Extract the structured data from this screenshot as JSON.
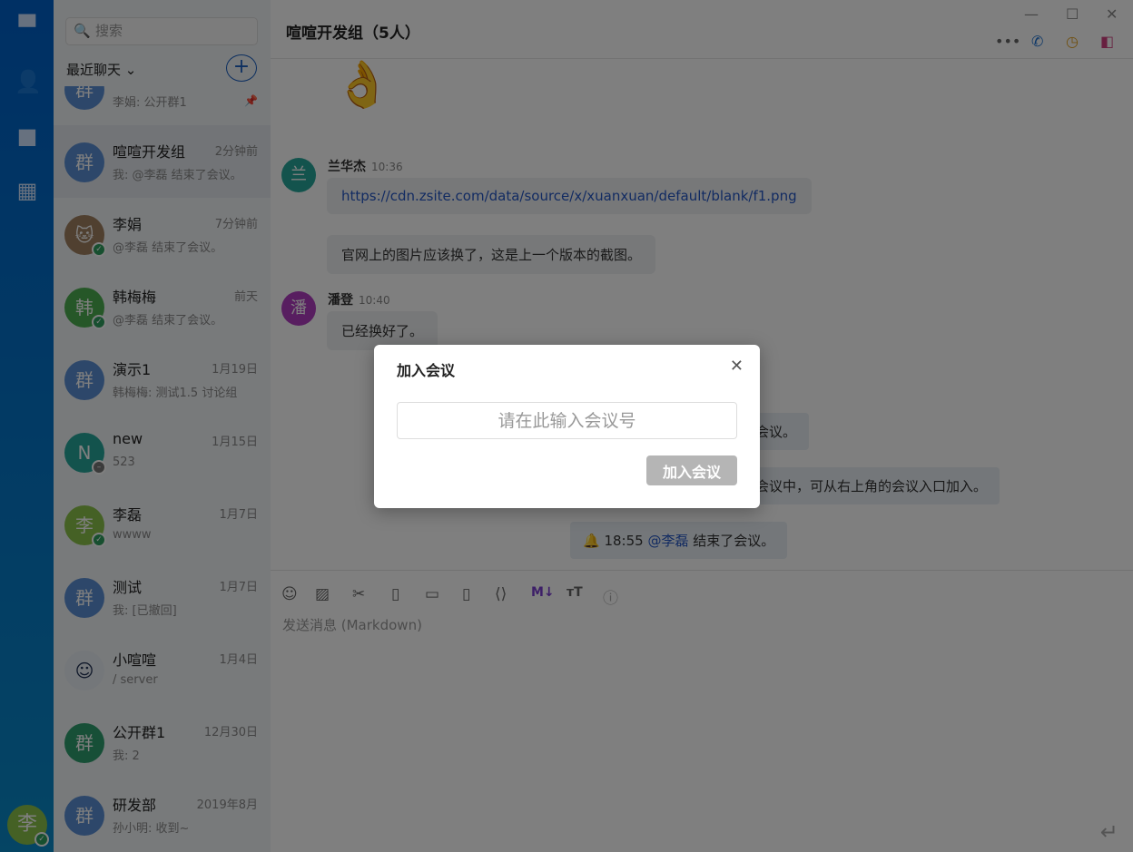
{
  "search": {
    "placeholder": "搜索"
  },
  "list_header": {
    "recent": "最近聊天 ⌄"
  },
  "chats": [
    {
      "name": "",
      "time": "",
      "preview": "李娟: 公开群1",
      "avatar": "群",
      "color": "#5b8fd4",
      "pinned": true
    },
    {
      "name": "喧喧开发组",
      "time": "2分钟前",
      "preview": "我: @李磊 结束了会议。",
      "avatar": "群",
      "color": "#5b8fd4"
    },
    {
      "name": "李娟",
      "time": "7分钟前",
      "preview": "@李磊 结束了会议。",
      "avatar": "🐱",
      "color": "#a08060"
    },
    {
      "name": "韩梅梅",
      "time": "前天",
      "preview": "@李磊 结束了会议。",
      "avatar": "韩",
      "color": "#4caf50"
    },
    {
      "name": "演示1",
      "time": "1月19日",
      "preview": "韩梅梅: 测试1.5 讨论组",
      "avatar": "群",
      "color": "#5b8fd4"
    },
    {
      "name": "new",
      "time": "1月15日",
      "preview": "523",
      "avatar": "N",
      "color": "#26a69a"
    },
    {
      "name": "李磊",
      "time": "1月7日",
      "preview": "wwww",
      "avatar": "李",
      "color": "#8bc34a"
    },
    {
      "name": "测试",
      "time": "1月7日",
      "preview": "我: [已撤回]",
      "avatar": "群",
      "color": "#5b8fd4"
    },
    {
      "name": "小喧喧",
      "time": "1月4日",
      "preview": "/ server",
      "avatar": "☺",
      "color": "#e8eef5"
    },
    {
      "name": "公开群1",
      "time": "12月30日",
      "preview": "我: 2",
      "avatar": "群",
      "color": "#2e9e6e"
    },
    {
      "name": "研发部",
      "time": "2019年8月",
      "preview": "孙小明: 收到~",
      "avatar": "群",
      "color": "#5b8fd4"
    }
  ],
  "me": {
    "avatar": "李"
  },
  "main": {
    "title": "喧喧开发组（5人）",
    "messages": [
      {
        "sender": "兰华杰",
        "time": "10:36",
        "avatar": "兰",
        "link": "https://cdn.zsite.com/data/source/x/xuanxuan/default/blank/f1.png",
        "text": "官网上的图片应该换了，这是上一个版本的截图。"
      },
      {
        "sender": "潘登",
        "time": "10:40",
        "avatar": "潘",
        "text": "已经换好了。"
      }
    ],
    "sys1": "会议。",
    "sys2": "会议中，可从右上角的会议入口加入。",
    "sys3_time": "18:55",
    "sys3_mention": "@李磊",
    "sys3_text": "结束了会议。",
    "composer_placeholder": "发送消息 (Markdown)"
  },
  "modal": {
    "title": "加入会议",
    "placeholder": "请在此输入会议号",
    "button": "加入会议"
  }
}
